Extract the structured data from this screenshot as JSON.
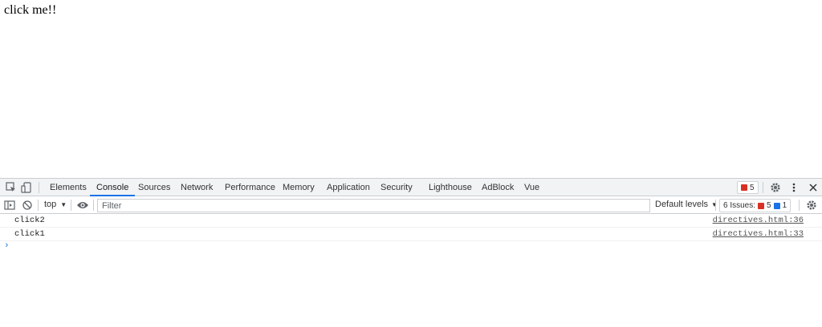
{
  "page": {
    "text": "click me!!"
  },
  "devtools": {
    "tabs": [
      {
        "label": "Elements",
        "active": false
      },
      {
        "label": "Console",
        "active": true
      },
      {
        "label": "Sources",
        "active": false
      },
      {
        "label": "Network",
        "active": false
      },
      {
        "label": "Performance",
        "active": false
      },
      {
        "label": "Memory",
        "active": false
      },
      {
        "label": "Application",
        "active": false
      },
      {
        "label": "Security",
        "active": false
      },
      {
        "label": "Lighthouse",
        "active": false
      },
      {
        "label": "AdBlock",
        "active": false
      },
      {
        "label": "Vue",
        "active": false
      }
    ],
    "error_count": "5",
    "toolbar": {
      "context": "top",
      "filter_placeholder": "Filter",
      "levels": "Default levels",
      "issues_label": "6 Issues:",
      "issues_errors": "5",
      "issues_info": "1"
    },
    "messages": [
      {
        "text": "click2",
        "source": "directives.html:36"
      },
      {
        "text": "click1",
        "source": "directives.html:33"
      }
    ],
    "prompt_symbol": "›"
  },
  "colors": {
    "accent": "#1a73e8",
    "error": "#d93025"
  }
}
